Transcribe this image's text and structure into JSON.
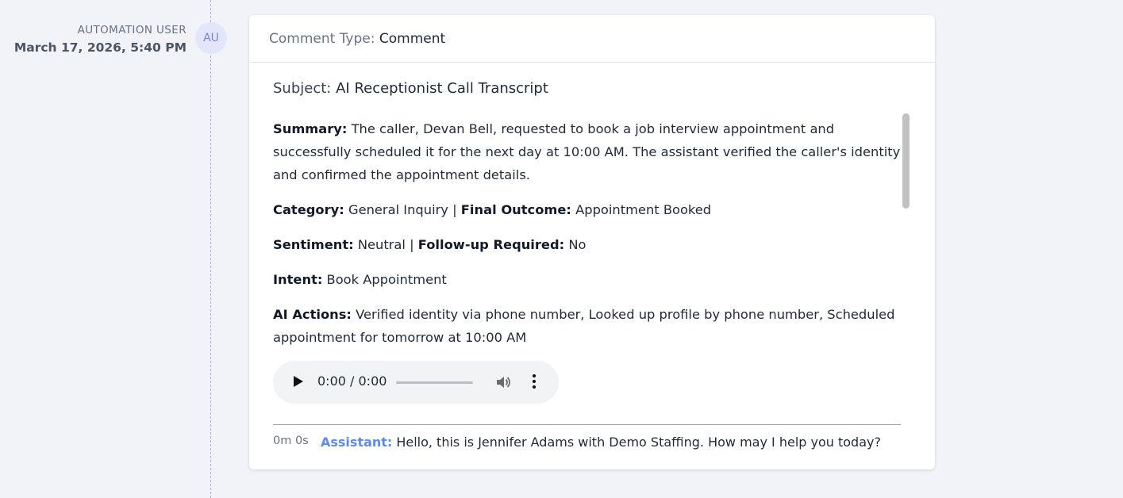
{
  "author": {
    "name": "AUTOMATION USER",
    "initials": "AU",
    "timestamp": "March 17, 2026, 5:40 PM"
  },
  "card": {
    "comment_type_label": "Comment Type:",
    "comment_type_value": "Comment",
    "subject_label": "Subject:",
    "subject_value": "AI Receptionist Call Transcript",
    "summary_label": "Summary:",
    "summary_text": "The caller, Devan Bell, requested to book a job interview appointment and successfully scheduled it for the next day at 10:00 AM. The assistant verified the caller's identity and confirmed the appointment details.",
    "category_label": "Category:",
    "category_value": "General Inquiry",
    "final_outcome_label": "Final Outcome:",
    "final_outcome_value": "Appointment Booked",
    "sentiment_label": "Sentiment:",
    "sentiment_value": "Neutral",
    "followup_label": "Follow-up Required:",
    "followup_value": "No",
    "intent_label": "Intent:",
    "intent_value": "Book Appointment",
    "ai_actions_label": "AI Actions:",
    "ai_actions_value": "Verified identity via phone number, Looked up profile by phone number, Scheduled appointment for tomorrow at 10:00 AM",
    "separator": "|",
    "audio": {
      "time": "0:00 / 0:00",
      "progress": 0
    },
    "transcript": [
      {
        "timestamp": "0m 0s",
        "speaker": "Assistant:",
        "text": "Hello, this is Jennifer Adams with Demo Staffing. How may I help you today?"
      }
    ]
  }
}
